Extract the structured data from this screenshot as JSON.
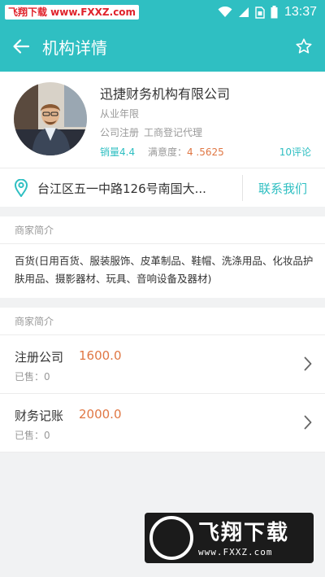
{
  "status_bar": {
    "watermark": "飞翔下载 www.FXXZ.com",
    "time": "13:37"
  },
  "header": {
    "title": "机构详情",
    "background": "#2fbfc2"
  },
  "merchant": {
    "name": "迅捷财务机构有限公司",
    "years": "从业年限",
    "services": [
      "公司注册",
      "工商登记代理"
    ],
    "sales_label": "销量",
    "sales_value": "4.4",
    "satisfaction_label": "满意度：",
    "satisfaction_value": "4 .5625",
    "reviews": "10评论"
  },
  "address": {
    "text": "台江区五一中路126号南国大...",
    "contact": "联系我们"
  },
  "intro_section": {
    "title": "商家简介",
    "text": "百货(日用百货、服装服饰、皮革制品、鞋帽、洗涤用品、化妆品护肤用品、摄影器材、玩具、音响设备及器材)"
  },
  "services_section": {
    "title": "商家简介",
    "items": [
      {
        "name": "注册公司",
        "price": "1600.0",
        "sold": "已售：0"
      },
      {
        "name": "财务记账",
        "price": "2000.0",
        "sold": "已售：0"
      }
    ]
  },
  "bottom_watermark": {
    "logo_text": "飞翔下载",
    "url": "www.FXXZ.com"
  },
  "colors": {
    "accent": "#2fbfc2",
    "price": "#e07744"
  },
  "icons": [
    "wifi-icon",
    "signal-icon",
    "sim-icon",
    "battery-icon",
    "back-arrow-icon",
    "star-icon",
    "location-pin-icon",
    "chevron-right-icon"
  ]
}
